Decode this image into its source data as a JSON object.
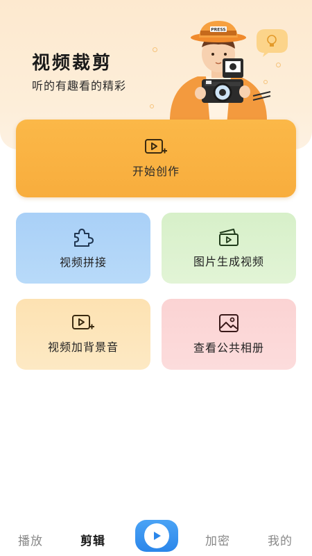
{
  "hero": {
    "title": "视频裁剪",
    "subtitle": "听的有趣看的精彩",
    "illustration": "photographer-with-camera",
    "hat_text": "PRESS"
  },
  "start_card": {
    "label": "开始创作",
    "icon": "video-add-icon"
  },
  "tiles": [
    {
      "label": "视频拼接",
      "icon": "puzzle-icon"
    },
    {
      "label": "图片生成视频",
      "icon": "photo-to-video-icon"
    },
    {
      "label": "视频加背景音",
      "icon": "video-add-icon"
    },
    {
      "label": "查看公共相册",
      "icon": "image-icon"
    }
  ],
  "tabbar": {
    "items": [
      {
        "label": "播放",
        "active": false
      },
      {
        "label": "剪辑",
        "active": true
      },
      {
        "label": "加密",
        "active": false
      },
      {
        "label": "我的",
        "active": false
      }
    ],
    "center_button": "play-icon"
  },
  "colors": {
    "accent_orange": "#f8ad3d",
    "tile_blue": "#a9d0f7",
    "tile_green": "#d7f0c9",
    "tile_yellow": "#fde2b2",
    "tile_pink": "#fbd3d3",
    "play_blue": "#2b86ea"
  }
}
